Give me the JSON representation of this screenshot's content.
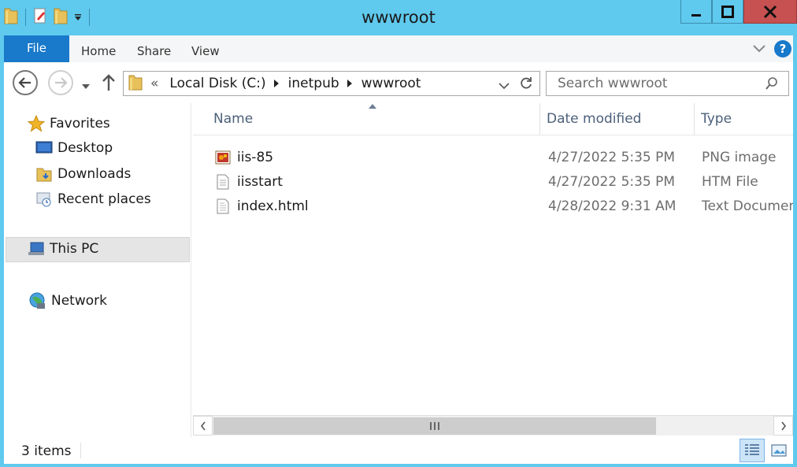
{
  "window": {
    "title": "wwwroot",
    "accent_color": "#5fc9ee",
    "close_color": "#c75050"
  },
  "quick_access": {
    "icons": [
      "folder-icon",
      "properties-icon",
      "new-folder-icon",
      "customize-dropdown-icon"
    ]
  },
  "ribbon": {
    "file_label": "File",
    "tabs": [
      "Home",
      "Share",
      "View"
    ]
  },
  "address": {
    "overflow": "«",
    "crumbs": [
      "Local Disk (C:)",
      "inetpub",
      "wwwroot"
    ]
  },
  "search": {
    "placeholder": "Search wwwroot"
  },
  "nav_pane": {
    "favorites_label": "Favorites",
    "favorites": [
      "Desktop",
      "Downloads",
      "Recent places"
    ],
    "this_pc_label": "This PC",
    "network_label": "Network"
  },
  "columns": {
    "name": "Name",
    "date_modified": "Date modified",
    "type": "Type"
  },
  "files": [
    {
      "name": "iis-85",
      "date": "4/27/2022 5:35 PM",
      "type": "PNG image",
      "icon": "png-image-icon"
    },
    {
      "name": "iisstart",
      "date": "4/27/2022 5:35 PM",
      "type": "HTM File",
      "icon": "htm-file-icon"
    },
    {
      "name": "index.html",
      "date": "4/28/2022 9:31 AM",
      "type": "Text Document",
      "icon": "text-document-icon"
    }
  ],
  "status": {
    "item_count": "3 items"
  }
}
